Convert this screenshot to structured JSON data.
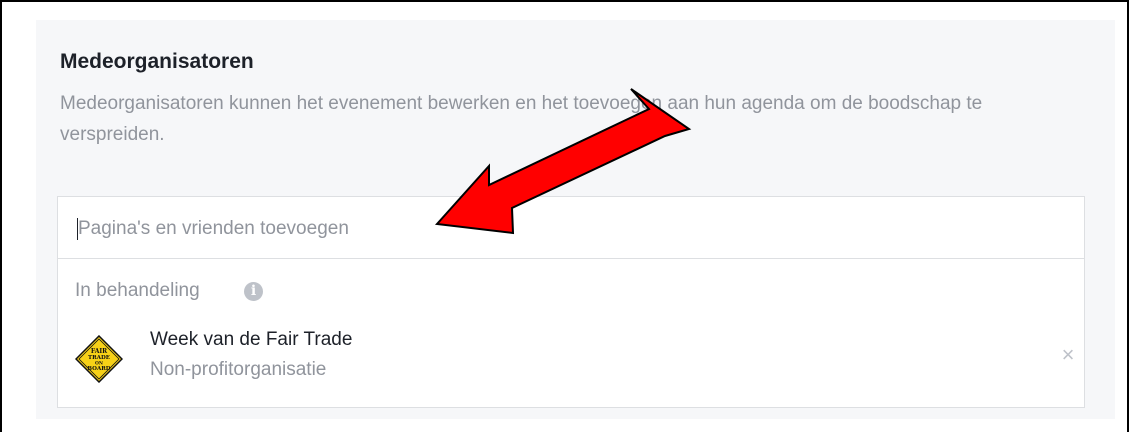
{
  "section": {
    "title": "Medeorganisatoren",
    "description": "Medeorganisatoren kunnen het evenement bewerken en het toevoegen aan hun agenda om de boodschap te verspreiden."
  },
  "search": {
    "placeholder": "Pagina's en vrienden toevoegen",
    "value": ""
  },
  "pending": {
    "label": "In behandeling",
    "info_icon": "info-icon"
  },
  "items": [
    {
      "name": "Week van de Fair Trade",
      "category": "Non-profitorganisatie",
      "logo_text": [
        "FAIR",
        "TRADE",
        "ON",
        "BOARD"
      ],
      "remove_symbol": "×"
    }
  ],
  "colors": {
    "panel_bg": "#f6f7f9",
    "arrow": "#ff0000",
    "logo_yellow": "#f7d117"
  }
}
